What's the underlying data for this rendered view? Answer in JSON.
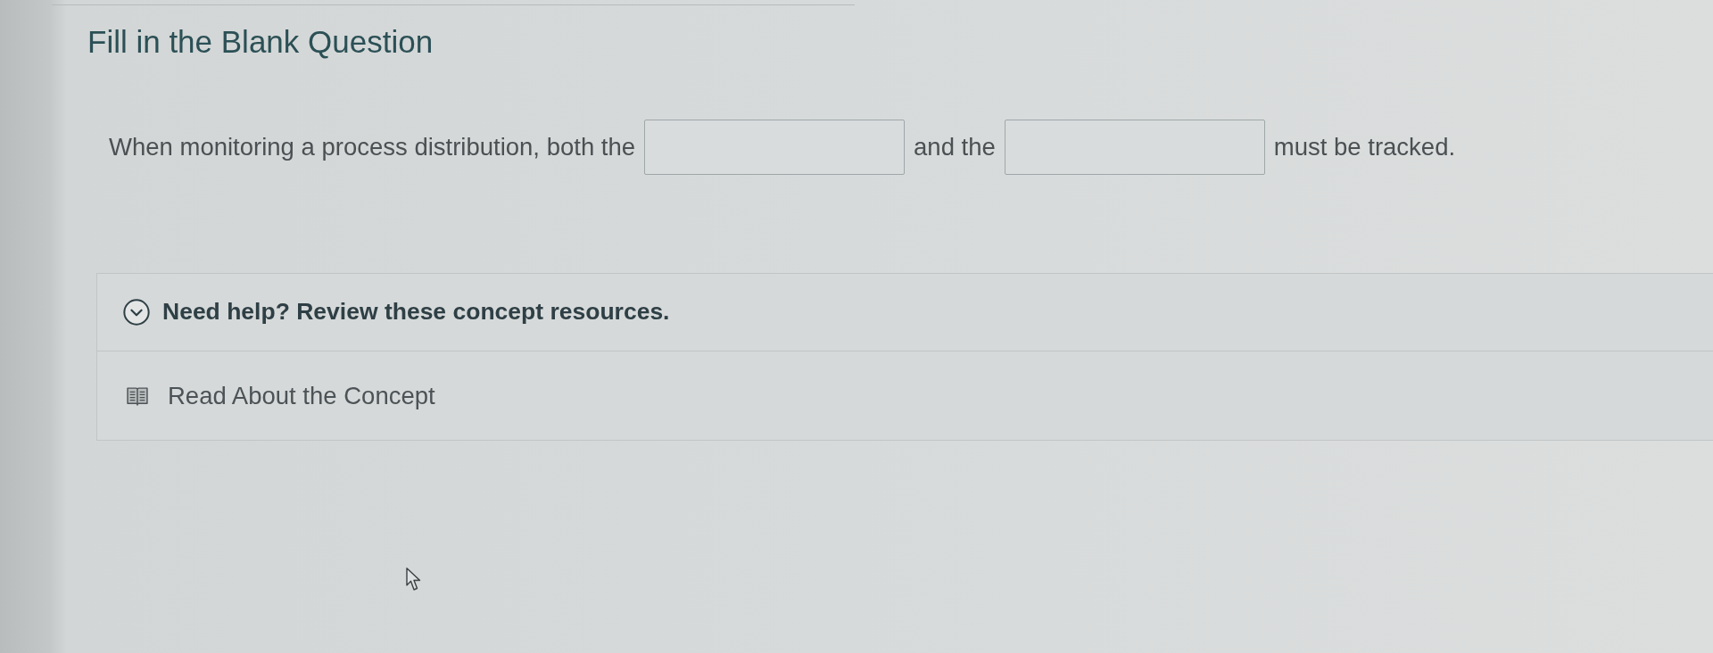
{
  "title": "Fill in the Blank Question",
  "question": {
    "parts": [
      {
        "kind": "text",
        "text": "When monitoring a process distribution, both the"
      },
      {
        "kind": "blank"
      },
      {
        "kind": "text",
        "text": "and the"
      },
      {
        "kind": "blank"
      },
      {
        "kind": "text",
        "text": "must be tracked."
      }
    ]
  },
  "help": {
    "heading": "Need help? Review these concept resources.",
    "expanded": true,
    "resources": [
      {
        "label": "Read About the Concept"
      }
    ]
  }
}
